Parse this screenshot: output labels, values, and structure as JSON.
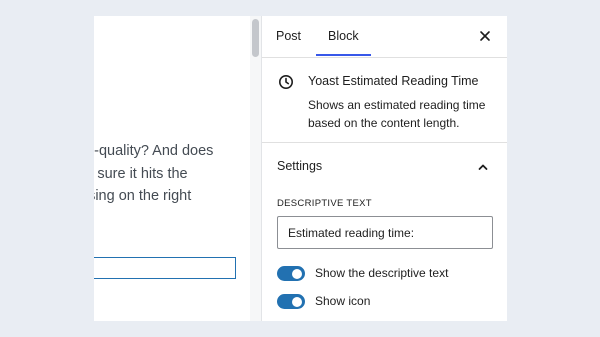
{
  "editor": {
    "lines": [
      "gh-quality? And does",
      "ke sure it hits the",
      "using on the right"
    ]
  },
  "sidebar": {
    "tabs": [
      {
        "label": "Post",
        "active": false
      },
      {
        "label": "Block",
        "active": true
      }
    ],
    "close_icon": "close-icon",
    "block": {
      "icon": "clock-icon",
      "title": "Yoast Estimated Reading Time",
      "description": "Shows an estimated reading time based on the content length."
    },
    "settings": {
      "title": "Settings",
      "expanded": true,
      "field_label": "DESCRIPTIVE TEXT",
      "field_value": "Estimated reading time:",
      "toggles": [
        {
          "label": "Show the descriptive text",
          "on": true
        },
        {
          "label": "Show icon",
          "on": true
        }
      ]
    }
  },
  "colors": {
    "background": "#e9edf3",
    "accent": "#2271b1",
    "tab_indicator": "#3858e9"
  }
}
